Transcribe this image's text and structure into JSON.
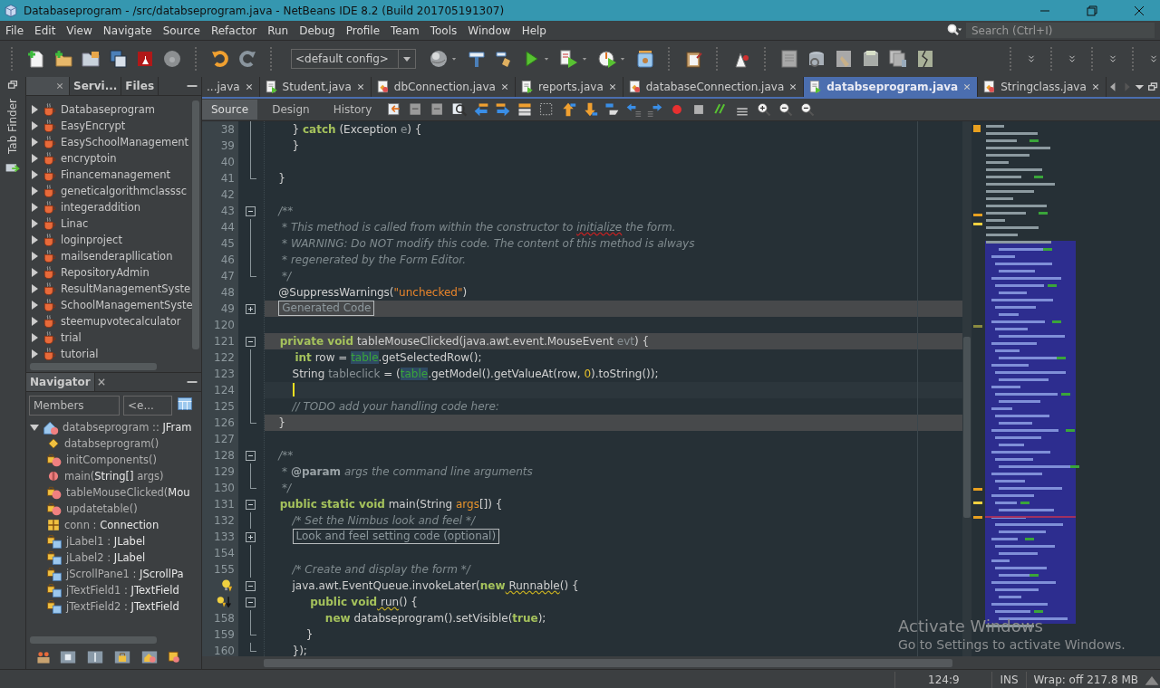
{
  "window": {
    "title": "Databaseprogram - /src/databseprogram.java - NetBeans IDE 8.2 (Build 201705191307)"
  },
  "menu": [
    "File",
    "Edit",
    "View",
    "Navigate",
    "Source",
    "Refactor",
    "Run",
    "Debug",
    "Profile",
    "Team",
    "Tools",
    "Window",
    "Help"
  ],
  "search": {
    "placeholder": "Search (Ctrl+I)"
  },
  "toolbar": {
    "config": "<default config>"
  },
  "side_strip": {
    "label": "Tab Finder"
  },
  "projects": {
    "tabs": [
      {
        "label": "Servi...",
        "selected": false
      },
      {
        "label": "Files",
        "selected": false
      }
    ],
    "items": [
      {
        "label": "Databaseprogram",
        "expanded": false
      },
      {
        "label": "EasyEncrypt",
        "expanded": false
      },
      {
        "label": "EasySchoolManagement",
        "expanded": false
      },
      {
        "label": "encryptoin",
        "expanded": false
      },
      {
        "label": "Financemanagement",
        "expanded": false
      },
      {
        "label": "geneticalgorithmclasssc",
        "expanded": false
      },
      {
        "label": "integeraddition",
        "expanded": false
      },
      {
        "label": "Linac",
        "expanded": false
      },
      {
        "label": "loginproject",
        "expanded": false
      },
      {
        "label": "mailsenderapllication",
        "expanded": false
      },
      {
        "label": "RepositoryAdmin",
        "expanded": false
      },
      {
        "label": "ResultManagementSyste",
        "expanded": false
      },
      {
        "label": "SchoolManagementSyste",
        "expanded": false
      },
      {
        "label": "steemupvotecalculator",
        "expanded": false
      },
      {
        "label": "trial",
        "expanded": false
      },
      {
        "label": "tutorial",
        "expanded": false
      }
    ]
  },
  "navigator": {
    "title": "Navigator",
    "filter": "Members",
    "filter_2": "<e...",
    "tree": [
      {
        "kind": "class",
        "expanded": true,
        "parts": [
          {
            "t": "databseprogram :: ",
            "kind": "name"
          },
          {
            "t": "JFram",
            "kind": "type"
          }
        ],
        "children": [
          {
            "kind": "constructor",
            "parts": [
              {
                "t": "databseprogram()",
                "kind": "name"
              }
            ]
          },
          {
            "kind": "private-method",
            "parts": [
              {
                "t": "initComponents()",
                "kind": "name"
              }
            ]
          },
          {
            "kind": "static-method",
            "parts": [
              {
                "t": "main(",
                "kind": "name"
              },
              {
                "t": "String[]",
                "kind": "type"
              },
              {
                "t": " args)",
                "kind": "name"
              }
            ]
          },
          {
            "kind": "private-method",
            "parts": [
              {
                "t": "tableMouseClicked(",
                "kind": "name"
              },
              {
                "t": "Mou",
                "kind": "type"
              }
            ]
          },
          {
            "kind": "private-method",
            "parts": [
              {
                "t": "updatetable()",
                "kind": "name"
              }
            ]
          },
          {
            "kind": "field",
            "parts": [
              {
                "t": "conn : ",
                "kind": "name"
              },
              {
                "t": "Connection",
                "kind": "type"
              }
            ]
          },
          {
            "kind": "private-field",
            "parts": [
              {
                "t": "jLabel1 : ",
                "kind": "name"
              },
              {
                "t": "JLabel",
                "kind": "type"
              }
            ]
          },
          {
            "kind": "private-field",
            "parts": [
              {
                "t": "jLabel2 : ",
                "kind": "name"
              },
              {
                "t": "JLabel",
                "kind": "type"
              }
            ]
          },
          {
            "kind": "private-field",
            "parts": [
              {
                "t": "jScrollPane1 : ",
                "kind": "name"
              },
              {
                "t": "JScrollPa",
                "kind": "type"
              }
            ]
          },
          {
            "kind": "private-field",
            "parts": [
              {
                "t": "jTextField1 : ",
                "kind": "name"
              },
              {
                "t": "JTextField",
                "kind": "type"
              }
            ]
          },
          {
            "kind": "private-field",
            "parts": [
              {
                "t": "jTextField2 : ",
                "kind": "name"
              },
              {
                "t": "JTextField",
                "kind": "type"
              }
            ]
          }
        ]
      }
    ]
  },
  "editor": {
    "tabs": [
      {
        "label": "...java",
        "selected": false
      },
      {
        "label": "Student.java",
        "selected": false
      },
      {
        "label": "dbConnection.java",
        "selected": false
      },
      {
        "label": "reports.java",
        "selected": false
      },
      {
        "label": "databaseConnection.java",
        "selected": false
      },
      {
        "label": "databseprogram.java",
        "selected": true
      },
      {
        "label": "Stringclass.java",
        "selected": false
      }
    ],
    "views": [
      {
        "label": "Source",
        "selected": true
      },
      {
        "label": "Design",
        "selected": false
      },
      {
        "label": "History",
        "selected": false
      }
    ],
    "lines": [
      {
        "num": "38",
        "fold": {
          "kind": "line"
        },
        "highlighted": false,
        "tokens": [
          {
            "t": "        } ",
            "kind": "plain"
          },
          {
            "t": "catch",
            "kind": "kw"
          },
          {
            "t": " (Exception ",
            "kind": "plain"
          },
          {
            "t": "e",
            "kind": "dim"
          },
          {
            "t": ") {",
            "kind": "plain"
          }
        ]
      },
      {
        "num": "39",
        "fold": {
          "kind": "line"
        },
        "highlighted": false,
        "tokens": [
          {
            "t": "        }",
            "kind": "plain"
          }
        ]
      },
      {
        "num": "40",
        "fold": {
          "kind": "line"
        },
        "highlighted": false
      },
      {
        "num": "41",
        "fold": {
          "kind": "end"
        },
        "highlighted": false,
        "tokens": [
          {
            "t": "    }",
            "kind": "plain"
          }
        ]
      },
      {
        "num": "42",
        "highlighted": false
      },
      {
        "num": "43",
        "fold": {
          "kind": "open"
        },
        "highlighted": false,
        "tokens": [
          {
            "t": "    /**",
            "kind": "comment"
          }
        ]
      },
      {
        "num": "44",
        "fold": {
          "kind": "line"
        },
        "highlighted": false,
        "tokens": [
          {
            "t": "     * This method is called from within the constructor to ",
            "kind": "comment"
          },
          {
            "t": "initialize",
            "kind": "spell"
          },
          {
            "t": " the form.",
            "kind": "comment"
          }
        ]
      },
      {
        "num": "45",
        "fold": {
          "kind": "line"
        },
        "highlighted": false,
        "tokens": [
          {
            "t": "     * WARNING: Do NOT modify this code. The content of this method is always",
            "kind": "comment"
          }
        ]
      },
      {
        "num": "46",
        "fold": {
          "kind": "line"
        },
        "highlighted": false,
        "tokens": [
          {
            "t": "     * regenerated by the Form Editor.",
            "kind": "comment"
          }
        ]
      },
      {
        "num": "47",
        "fold": {
          "kind": "end"
        },
        "highlighted": false,
        "tokens": [
          {
            "t": "     */",
            "kind": "comment"
          }
        ]
      },
      {
        "num": "48",
        "highlighted": false,
        "tokens": [
          {
            "t": "    @SuppressWarnings(",
            "kind": "plain"
          },
          {
            "t": "\"unchecked\"",
            "kind": "string"
          },
          {
            "t": ")",
            "kind": "plain"
          }
        ]
      },
      {
        "num": "49",
        "fold": {
          "kind": "closed"
        },
        "highlighted": true,
        "tokens": [
          {
            "t": "Generated Code",
            "kind": "folded"
          }
        ]
      },
      {
        "num": "120",
        "highlighted": false
      },
      {
        "num": "121",
        "fold": {
          "kind": "open"
        },
        "highlighted": true,
        "tokens": [
          {
            "t": "    private void",
            "kind": "kw"
          },
          {
            "t": " tableMouseClicked(java.awt.event.MouseEvent ",
            "kind": "plain"
          },
          {
            "t": "evt",
            "kind": "dim"
          },
          {
            "t": ") {",
            "kind": "plain"
          }
        ]
      },
      {
        "num": "122",
        "fold": {
          "kind": "line"
        },
        "highlighted": false,
        "tokens": [
          {
            "t": "        int",
            "kind": "kw"
          },
          {
            "t": " row = ",
            "kind": "plain"
          },
          {
            "t": "table",
            "kind": "field"
          },
          {
            "t": ".getSelectedRow();",
            "kind": "plain"
          }
        ]
      },
      {
        "num": "123",
        "fold": {
          "kind": "line"
        },
        "highlighted": false,
        "tokens": [
          {
            "t": "        String ",
            "kind": "plain"
          },
          {
            "t": "tableclick",
            "kind": "dim"
          },
          {
            "t": " = (",
            "kind": "plain"
          },
          {
            "t": "table",
            "kind": "field"
          },
          {
            "t": ".getModel().getValueAt(row, ",
            "kind": "plain"
          },
          {
            "t": "0",
            "kind": "number"
          },
          {
            "t": ").toString());",
            "kind": "plain"
          }
        ]
      },
      {
        "num": "124",
        "fold": {
          "kind": "line"
        },
        "highlighted": false,
        "caret": true
      },
      {
        "num": "125",
        "fold": {
          "kind": "line"
        },
        "highlighted": false,
        "tokens": [
          {
            "t": "        // TODO add your handling code here:",
            "kind": "comment"
          }
        ]
      },
      {
        "num": "126",
        "fold": {
          "kind": "end"
        },
        "highlighted": true,
        "tokens": [
          {
            "t": "    }",
            "kind": "plain"
          }
        ]
      },
      {
        "num": "127",
        "highlighted": false
      },
      {
        "num": "128",
        "fold": {
          "kind": "open"
        },
        "highlighted": false,
        "tokens": [
          {
            "t": "    /**",
            "kind": "comment"
          }
        ]
      },
      {
        "num": "129",
        "fold": {
          "kind": "line"
        },
        "highlighted": false,
        "tokens": [
          {
            "t": "     * ",
            "kind": "comment"
          },
          {
            "t": "@param",
            "kind": "doctag"
          },
          {
            "t": " args the command line arguments",
            "kind": "comment"
          }
        ]
      },
      {
        "num": "130",
        "fold": {
          "kind": "end"
        },
        "highlighted": false,
        "tokens": [
          {
            "t": "     */",
            "kind": "comment"
          }
        ]
      },
      {
        "num": "131",
        "fold": {
          "kind": "open"
        },
        "highlighted": false,
        "tokens": [
          {
            "t": "    public static void",
            "kind": "kw"
          },
          {
            "t": " main(String ",
            "kind": "plain"
          },
          {
            "t": "args",
            "kind": "param"
          },
          {
            "t": "[]) {",
            "kind": "plain"
          }
        ]
      },
      {
        "num": "132",
        "fold": {
          "kind": "line"
        },
        "highlighted": false,
        "tokens": [
          {
            "t": "        /* Set the Nimbus look and feel */",
            "kind": "comment"
          }
        ]
      },
      {
        "num": "133",
        "fold": {
          "kind": "closed"
        },
        "highlighted": false,
        "tokens": [
          {
            "t": "Look and feel setting code (optional)",
            "kind": "folded"
          }
        ]
      },
      {
        "num": "154",
        "fold": {
          "kind": "line"
        },
        "highlighted": false
      },
      {
        "num": "155",
        "fold": {
          "kind": "line"
        },
        "highlighted": false,
        "tokens": [
          {
            "t": "        /* Create and display the form */",
            "kind": "comment"
          }
        ]
      },
      {
        "marker": {
          "kind": "hint"
        },
        "fold": {
          "kind": "open"
        },
        "highlighted": false,
        "tokens": [
          {
            "t": "        java.awt.EventQueue.invokeLater(",
            "kind": "plain"
          },
          {
            "t": "new",
            "kind": "kw"
          },
          {
            "t": " Runnable",
            "kind": "warn"
          },
          {
            "t": "() {",
            "kind": "plain"
          }
        ]
      },
      {
        "marker": {
          "kind": "hint-down"
        },
        "fold": {
          "kind": "open"
        },
        "highlighted": false,
        "tokens": [
          {
            "t": "            public void",
            "kind": "kw"
          },
          {
            "t": " run",
            "kind": "warn"
          },
          {
            "t": "() {",
            "kind": "plain"
          }
        ]
      },
      {
        "num": "158",
        "fold": {
          "kind": "line"
        },
        "highlighted": false,
        "tokens": [
          {
            "t": "                new",
            "kind": "kw"
          },
          {
            "t": " databseprogram().setVisible(",
            "kind": "plain"
          },
          {
            "t": "true",
            "kind": "kw"
          },
          {
            "t": ");",
            "kind": "plain"
          }
        ]
      },
      {
        "num": "159",
        "fold": {
          "kind": "end"
        },
        "highlighted": false,
        "tokens": [
          {
            "t": "            }",
            "kind": "plain"
          }
        ]
      },
      {
        "num": "160",
        "fold": {
          "kind": "end"
        },
        "highlighted": false,
        "tokens": [
          {
            "t": "        });",
            "kind": "plain"
          }
        ]
      }
    ]
  },
  "os_notice": {
    "title": "Activate Windows",
    "text": "Go to Settings to activate Windows."
  },
  "status_bar": {
    "position": "124:9",
    "mode": "INS",
    "wrap": "Wrap: off",
    "memory": "217.8 MB"
  }
}
